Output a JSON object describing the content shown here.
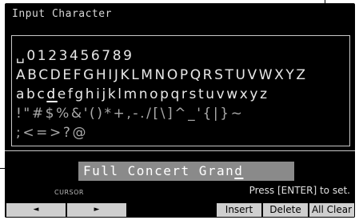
{
  "dialog": {
    "title": "Input Character"
  },
  "character_grid": {
    "rows": [
      "␣0123456789",
      "ABCDEFGHIJKLMNOPQRSTUVWXYZ",
      "abcdefghijklmnopqrstuvwxyz",
      "!\"#$%&'()*+,-./[\\]^_'{|}~",
      ";<=>?@"
    ],
    "selected_char": "d",
    "row3_pre": "abc",
    "row3_post": "efghijklmnopqrstuvwxyz"
  },
  "name_field": {
    "value_pre": "Full Concert Gran",
    "value_cursor": "d"
  },
  "footer": {
    "cursor_label": "CURSOR",
    "hint": "Press [ENTER] to set."
  },
  "buttons": {
    "left": "◄",
    "right": "►",
    "insert": "Insert",
    "delete": "Delete",
    "all_clear": "All Clear"
  }
}
